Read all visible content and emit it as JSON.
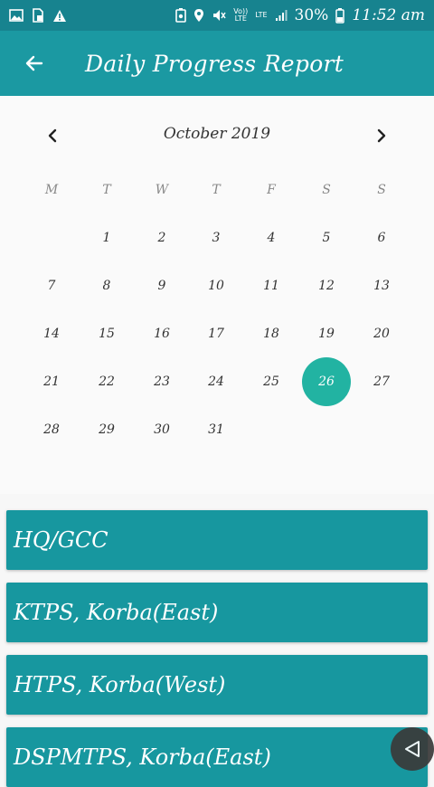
{
  "status_bar": {
    "volte": "Vo))",
    "lte_top": "LTE",
    "lte_small": "LTE",
    "battery": "30%",
    "time": "11:52 am"
  },
  "app_bar": {
    "title": "Daily Progress Report",
    "back_icon": "arrow-left-icon"
  },
  "calendar": {
    "month_label": "October 2019",
    "weekdays": [
      "M",
      "T",
      "W",
      "T",
      "F",
      "S",
      "S"
    ],
    "selected_day": "26",
    "weeks": [
      [
        "",
        "1",
        "2",
        "3",
        "4",
        "5",
        "6"
      ],
      [
        "7",
        "8",
        "9",
        "10",
        "11",
        "12",
        "13"
      ],
      [
        "14",
        "15",
        "16",
        "17",
        "18",
        "19",
        "20"
      ],
      [
        "21",
        "22",
        "23",
        "24",
        "25",
        "26",
        "27"
      ],
      [
        "28",
        "29",
        "30",
        "31",
        "",
        "",
        ""
      ]
    ]
  },
  "sites": [
    {
      "label": "HQ/GCC"
    },
    {
      "label": "KTPS, Korba(East)"
    },
    {
      "label": "HTPS, Korba(West)"
    },
    {
      "label": "DSPMTPS, Korba(East)"
    }
  ],
  "colors": {
    "status_bar": "#17838f",
    "app_bar": "#1b99a2",
    "selected_day": "#22b3a2",
    "list_item": "#17979f"
  }
}
